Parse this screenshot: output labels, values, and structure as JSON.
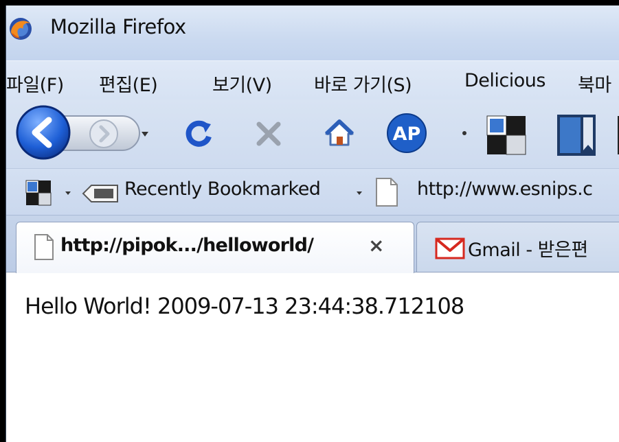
{
  "window": {
    "title": "Mozilla Firefox"
  },
  "menubar": {
    "items": [
      "파일(F)",
      "편집(E)",
      "보기(V)",
      "바로 가기(S)",
      "Delicious",
      "북마"
    ]
  },
  "navbar": {
    "icons": [
      "back-icon",
      "forward-icon",
      "history-dropdown-icon",
      "reload-icon",
      "stop-icon",
      "home-icon",
      "addon-ap-icon",
      "delicious-icon",
      "bookmark-tag-icon"
    ]
  },
  "bookmarks": {
    "recently_bookmarked": "Recently Bookmarked",
    "esnips": "http://www.esnips.c"
  },
  "tabs": [
    {
      "label": "http://pipok.../helloworld/",
      "active": true
    },
    {
      "label": "Gmail - 받은편",
      "active": false
    }
  ],
  "content": {
    "text": "Hello World! 2009-07-13 23:44:38.712108"
  },
  "colors": {
    "chrome": "#cfdcf0",
    "back_button": "#1e5fd6",
    "reload": "#1f55c8",
    "gmail_red": "#d6281f"
  }
}
